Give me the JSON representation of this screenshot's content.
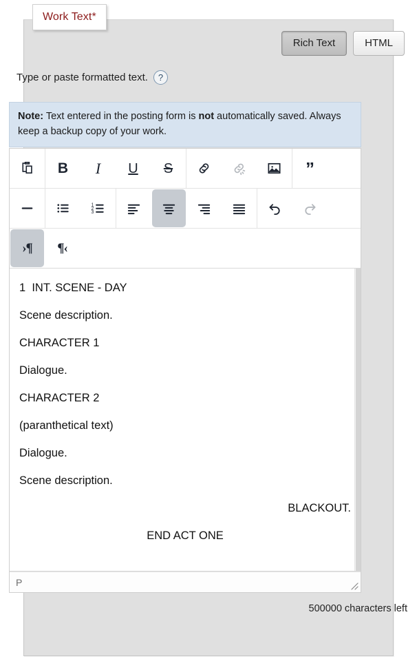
{
  "legend": {
    "label": "Work Text*"
  },
  "mode_toggle": {
    "rich_text_label": "Rich Text",
    "html_label": "HTML",
    "selected": "Rich Text"
  },
  "instruction": {
    "text": "Type or paste formatted text.",
    "help_icon": "help-question-icon",
    "help_glyph": "?"
  },
  "note": {
    "label": "Note:",
    "body_part1": " Text entered in the posting form is ",
    "emphasis": "not",
    "body_part2": " automatically saved. Always keep a backup copy of your work."
  },
  "toolbar": {
    "rows": [
      {
        "groups": [
          {
            "buttons": [
              {
                "name": "paste-icon",
                "title": "Paste"
              }
            ]
          },
          {
            "buttons": [
              {
                "name": "bold-icon",
                "title": "Bold",
                "glyph": "B"
              },
              {
                "name": "italic-icon",
                "title": "Italic",
                "glyph": "I"
              },
              {
                "name": "underline-icon",
                "title": "Underline",
                "glyph": "U"
              },
              {
                "name": "strikethrough-icon",
                "title": "Strikethrough",
                "glyph": "S"
              }
            ]
          },
          {
            "buttons": [
              {
                "name": "link-icon",
                "title": "Insert link"
              },
              {
                "name": "unlink-icon",
                "title": "Remove link",
                "state": "disabled"
              },
              {
                "name": "image-icon",
                "title": "Insert image"
              }
            ]
          },
          {
            "buttons": [
              {
                "name": "blockquote-icon",
                "title": "Blockquote",
                "glyph": "”"
              }
            ]
          }
        ]
      },
      {
        "groups": [
          {
            "buttons": [
              {
                "name": "horizontal-rule-icon",
                "title": "Horizontal rule"
              }
            ]
          },
          {
            "buttons": [
              {
                "name": "bullet-list-icon",
                "title": "Bulleted list"
              },
              {
                "name": "numbered-list-icon",
                "title": "Numbered list"
              }
            ]
          },
          {
            "buttons": [
              {
                "name": "align-left-icon",
                "title": "Align left"
              },
              {
                "name": "align-center-icon",
                "title": "Align center",
                "state": "active"
              },
              {
                "name": "align-right-icon",
                "title": "Align right"
              },
              {
                "name": "align-justify-icon",
                "title": "Justify"
              }
            ]
          },
          {
            "buttons": [
              {
                "name": "undo-icon",
                "title": "Undo"
              },
              {
                "name": "redo-icon",
                "title": "Redo",
                "state": "disabled"
              }
            ]
          }
        ]
      },
      {
        "groups": [
          {
            "buttons": [
              {
                "name": "indent-icon",
                "title": "Increase indent",
                "state": "active",
                "glyph": "›¶"
              },
              {
                "name": "outdent-icon",
                "title": "Decrease indent",
                "glyph": "¶‹"
              }
            ]
          }
        ]
      }
    ]
  },
  "content": {
    "paragraphs": [
      {
        "text": "1  INT. SCENE - DAY",
        "align": "left"
      },
      {
        "text": "Scene description.",
        "align": "left"
      },
      {
        "text": "CHARACTER 1",
        "align": "left"
      },
      {
        "text": "Dialogue.",
        "align": "left"
      },
      {
        "text": "CHARACTER 2",
        "align": "left"
      },
      {
        "text": "(paranthetical text)",
        "align": "left"
      },
      {
        "text": "Dialogue.",
        "align": "left"
      },
      {
        "text": "Scene description.",
        "align": "left"
      },
      {
        "text": "BLACKOUT.",
        "align": "right"
      },
      {
        "text": "END ACT ONE",
        "align": "center"
      }
    ]
  },
  "statusbar": {
    "element_path": "P",
    "resize_handle": "resize-grip-icon"
  },
  "counter": {
    "text": "500000 characters left"
  },
  "colors": {
    "legend_text": "#8c1b1b",
    "panel_bg": "#e0e0e0",
    "note_bg": "#d7e3f0",
    "toolbar_icon": "#1d2430",
    "toolbar_active_bg": "#c6cbd1",
    "disabled_icon": "#b4b8bd"
  }
}
